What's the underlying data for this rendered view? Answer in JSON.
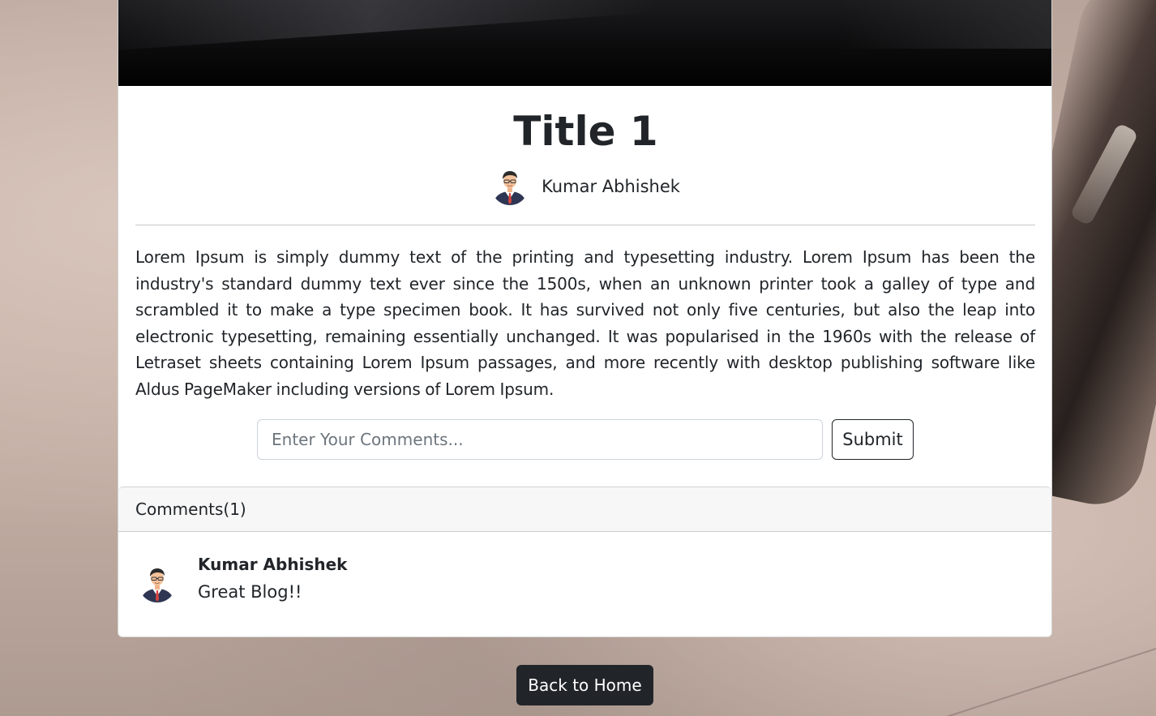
{
  "post": {
    "title": "Title 1",
    "author": "Kumar Abhishek",
    "body": "Lorem Ipsum is simply dummy text of the printing and typesetting industry. Lorem Ipsum has been the industry's standard dummy text ever since the 1500s, when an unknown printer took a galley of type and scrambled it to make a type specimen book. It has survived not only five centuries, but also the leap into electronic typesetting, remaining essentially unchanged. It was popularised in the 1960s with the release of Letraset sheets containing Lorem Ipsum passages, and more recently with desktop publishing software like Aldus PageMaker including versions of Lorem Ipsum."
  },
  "comment_form": {
    "placeholder": "Enter Your Comments...",
    "value": "",
    "submit_label": "Submit"
  },
  "comments": {
    "header": "Comments(1)",
    "items": [
      {
        "author": "Kumar Abhishek",
        "text": "Great Blog!!"
      }
    ]
  },
  "nav": {
    "back_label": "Back to Home"
  },
  "icons": {
    "avatar": "user-avatar-icon"
  },
  "colors": {
    "dark_button": "#212529",
    "card_header_bg": "#f7f7f7"
  }
}
